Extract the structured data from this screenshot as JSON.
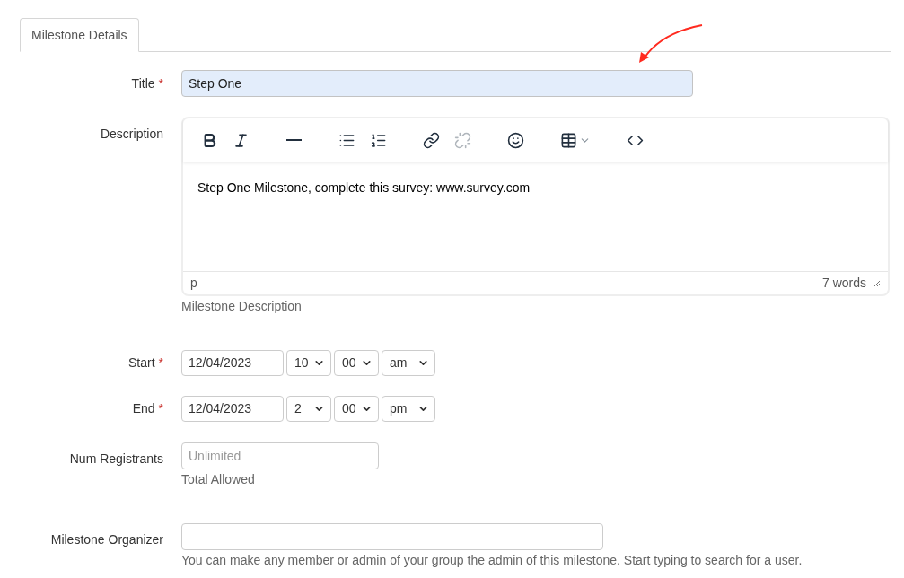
{
  "tabs": [
    {
      "label": "Milestone Details",
      "selected": true
    }
  ],
  "title_field": {
    "label": "Title",
    "required_mark": "*",
    "value": "Step One"
  },
  "description": {
    "label": "Description",
    "toolbar": [
      {
        "kind": "bold",
        "disabled": false
      },
      {
        "kind": "italic",
        "disabled": false
      },
      {
        "kind": "rule",
        "disabled": false
      },
      {
        "kind": "bullets",
        "disabled": false
      },
      {
        "kind": "numbers",
        "disabled": false
      },
      {
        "kind": "link",
        "disabled": false
      },
      {
        "kind": "unlink",
        "disabled": true
      },
      {
        "kind": "emoji",
        "disabled": false
      },
      {
        "kind": "table",
        "disabled": false
      },
      {
        "kind": "code",
        "disabled": false
      }
    ],
    "content": "Step One Milestone, complete this survey: www.survey.com",
    "path": "p",
    "word_count": "7 words",
    "help": "Milestone Description"
  },
  "schedule": [
    {
      "label": "Start",
      "required_mark": "*",
      "date": "12/04/2023",
      "hour": "10",
      "minute": "00",
      "period": "am"
    },
    {
      "label": "End",
      "required_mark": "*",
      "date": "12/04/2023",
      "hour": "2",
      "minute": "00",
      "period": "pm"
    }
  ],
  "num_registrants": {
    "label": "Num Registrants",
    "placeholder": "Unlimited",
    "help": "Total Allowed"
  },
  "organizer": {
    "label": "Milestone Organizer",
    "help": "You can make any member or admin of your group the admin of this milestone. Start typing to search for a user."
  }
}
